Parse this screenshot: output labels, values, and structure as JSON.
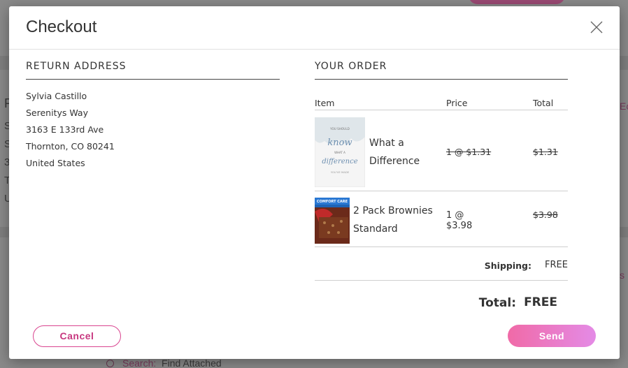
{
  "background": {
    "search_label": "Search:",
    "search_value": "Find Attached",
    "left_letters": [
      "F",
      "S",
      "S",
      "3",
      "T",
      "U"
    ],
    "edge_text_1": "Ec",
    "edge_text_2": "s"
  },
  "modal": {
    "title": "Checkout",
    "return_address": {
      "heading": "RETURN ADDRESS",
      "lines": [
        "Sylvia Castillo",
        "Serenitys Way",
        "3163 E 133rd Ave",
        "Thornton, CO 80241",
        "United States"
      ]
    },
    "order": {
      "heading": "YOUR ORDER",
      "columns": {
        "item": "Item",
        "price": "Price",
        "total": "Total"
      },
      "items": [
        {
          "name_line1": "What a",
          "name_line2": "Difference",
          "price": "1 @ $1.31",
          "total": "$1.31",
          "cover_small_top": "YOU SHOULD",
          "cover_word1": "know",
          "cover_small_mid": "WHAT A",
          "cover_word2": "difference",
          "cover_small_bottom": "YOU'VE MADE"
        },
        {
          "name_line1": "2 Pack Brownies",
          "name_line2": "Standard",
          "price_line1": "1 @",
          "price_line2": "$3.98",
          "total": "$3.98",
          "thumb_banner": "COMFORT CARE"
        }
      ],
      "shipping_label": "Shipping:",
      "shipping_value": "FREE",
      "total_label": "Total:",
      "total_value": "FREE"
    },
    "buttons": {
      "cancel": "Cancel",
      "send": "Send"
    }
  },
  "colors": {
    "accent": "#d9448f",
    "send_gradient_start": "#f06aa7",
    "send_gradient_end": "#e48be6"
  }
}
